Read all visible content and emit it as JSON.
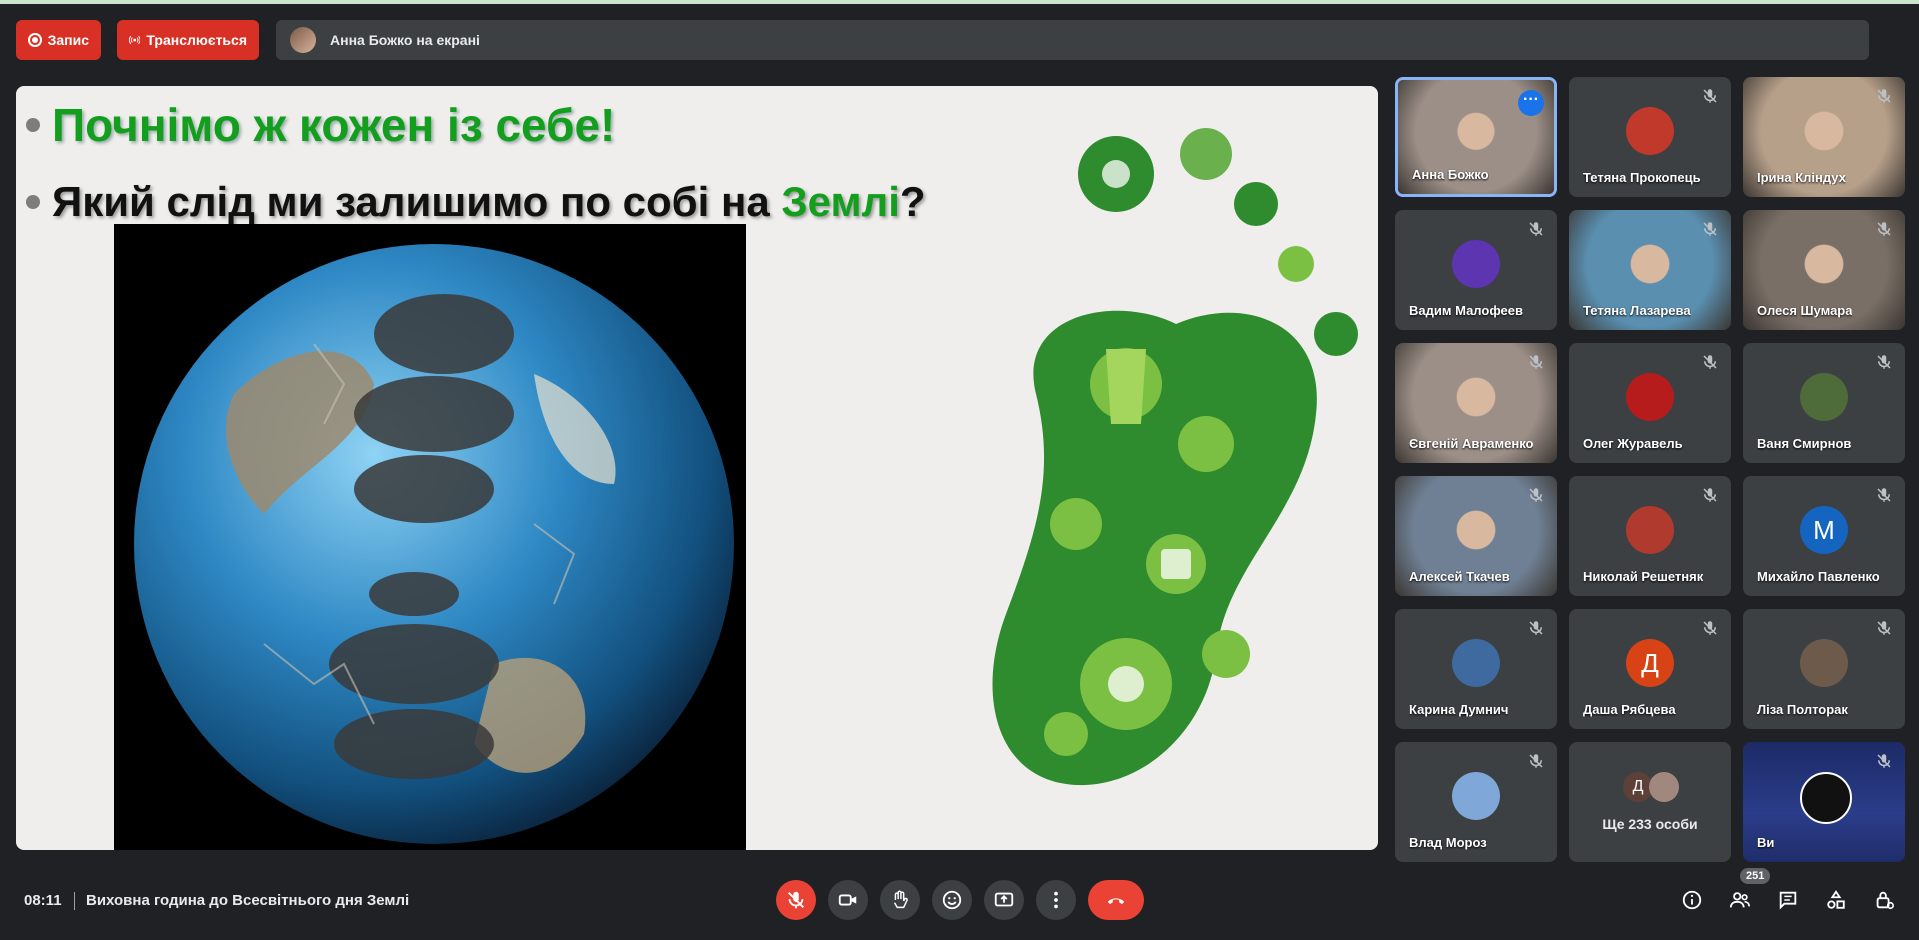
{
  "topbar": {
    "record_label": "Запис",
    "live_label": "Транслюється",
    "presenting_text": "Анна Божко на екрані"
  },
  "slide": {
    "line1": "Почнімо ж кожен із себе!",
    "line2_prefix": "Який слід ми залишимо по собі на ",
    "line2_highlight": "Землі",
    "line2_suffix": "?"
  },
  "participants": [
    {
      "name": "Анна Божко",
      "kind": "video",
      "active": true
    },
    {
      "name": "Тетяна Прокопець",
      "kind": "avatar",
      "color": "#c0392b",
      "letter": ""
    },
    {
      "name": "Ірина Кліндух",
      "kind": "video"
    },
    {
      "name": "Вадим Малофеев",
      "kind": "avatar",
      "color": "#5e35b1",
      "letter": ""
    },
    {
      "name": "Тетяна Лазарева",
      "kind": "video"
    },
    {
      "name": "Олеся Шумара",
      "kind": "video"
    },
    {
      "name": "Євгеній Авраменко",
      "kind": "video"
    },
    {
      "name": "Олег Журавель",
      "kind": "avatar",
      "color": "#b71c1c",
      "letter": ""
    },
    {
      "name": "Ваня Смирнов",
      "kind": "avatar",
      "color": "#4e6b3a",
      "letter": ""
    },
    {
      "name": "Алексей Ткачев",
      "kind": "video"
    },
    {
      "name": "Николай Решетняк",
      "kind": "avatar",
      "color": "#b03a2e",
      "letter": ""
    },
    {
      "name": "Михайло Павленко",
      "kind": "avatar",
      "color": "#1565c0",
      "letter": "М"
    },
    {
      "name": "Карина Думнич",
      "kind": "avatar",
      "color": "#3f6aa0",
      "letter": ""
    },
    {
      "name": "Даша Рябцева",
      "kind": "avatar",
      "color": "#d84315",
      "letter": "Д"
    },
    {
      "name": "Ліза Полторак",
      "kind": "avatar",
      "color": "#6d5a4a",
      "letter": ""
    },
    {
      "name": "Влад Мороз",
      "kind": "avatar",
      "color": "#7fa7d8",
      "letter": ""
    },
    {
      "name": "Ще 233 особи",
      "kind": "more"
    },
    {
      "name": "Ви",
      "kind": "self"
    }
  ],
  "more_tile": {
    "avatar_letter": "Д"
  },
  "bottombar": {
    "time": "08:11",
    "meeting_title": "Виховна година до Всесвітнього дня Землі",
    "participants_count": "251"
  },
  "colors": {
    "accent": "#1a73e8",
    "danger": "#ea4335",
    "slide_green": "#149e1d"
  }
}
